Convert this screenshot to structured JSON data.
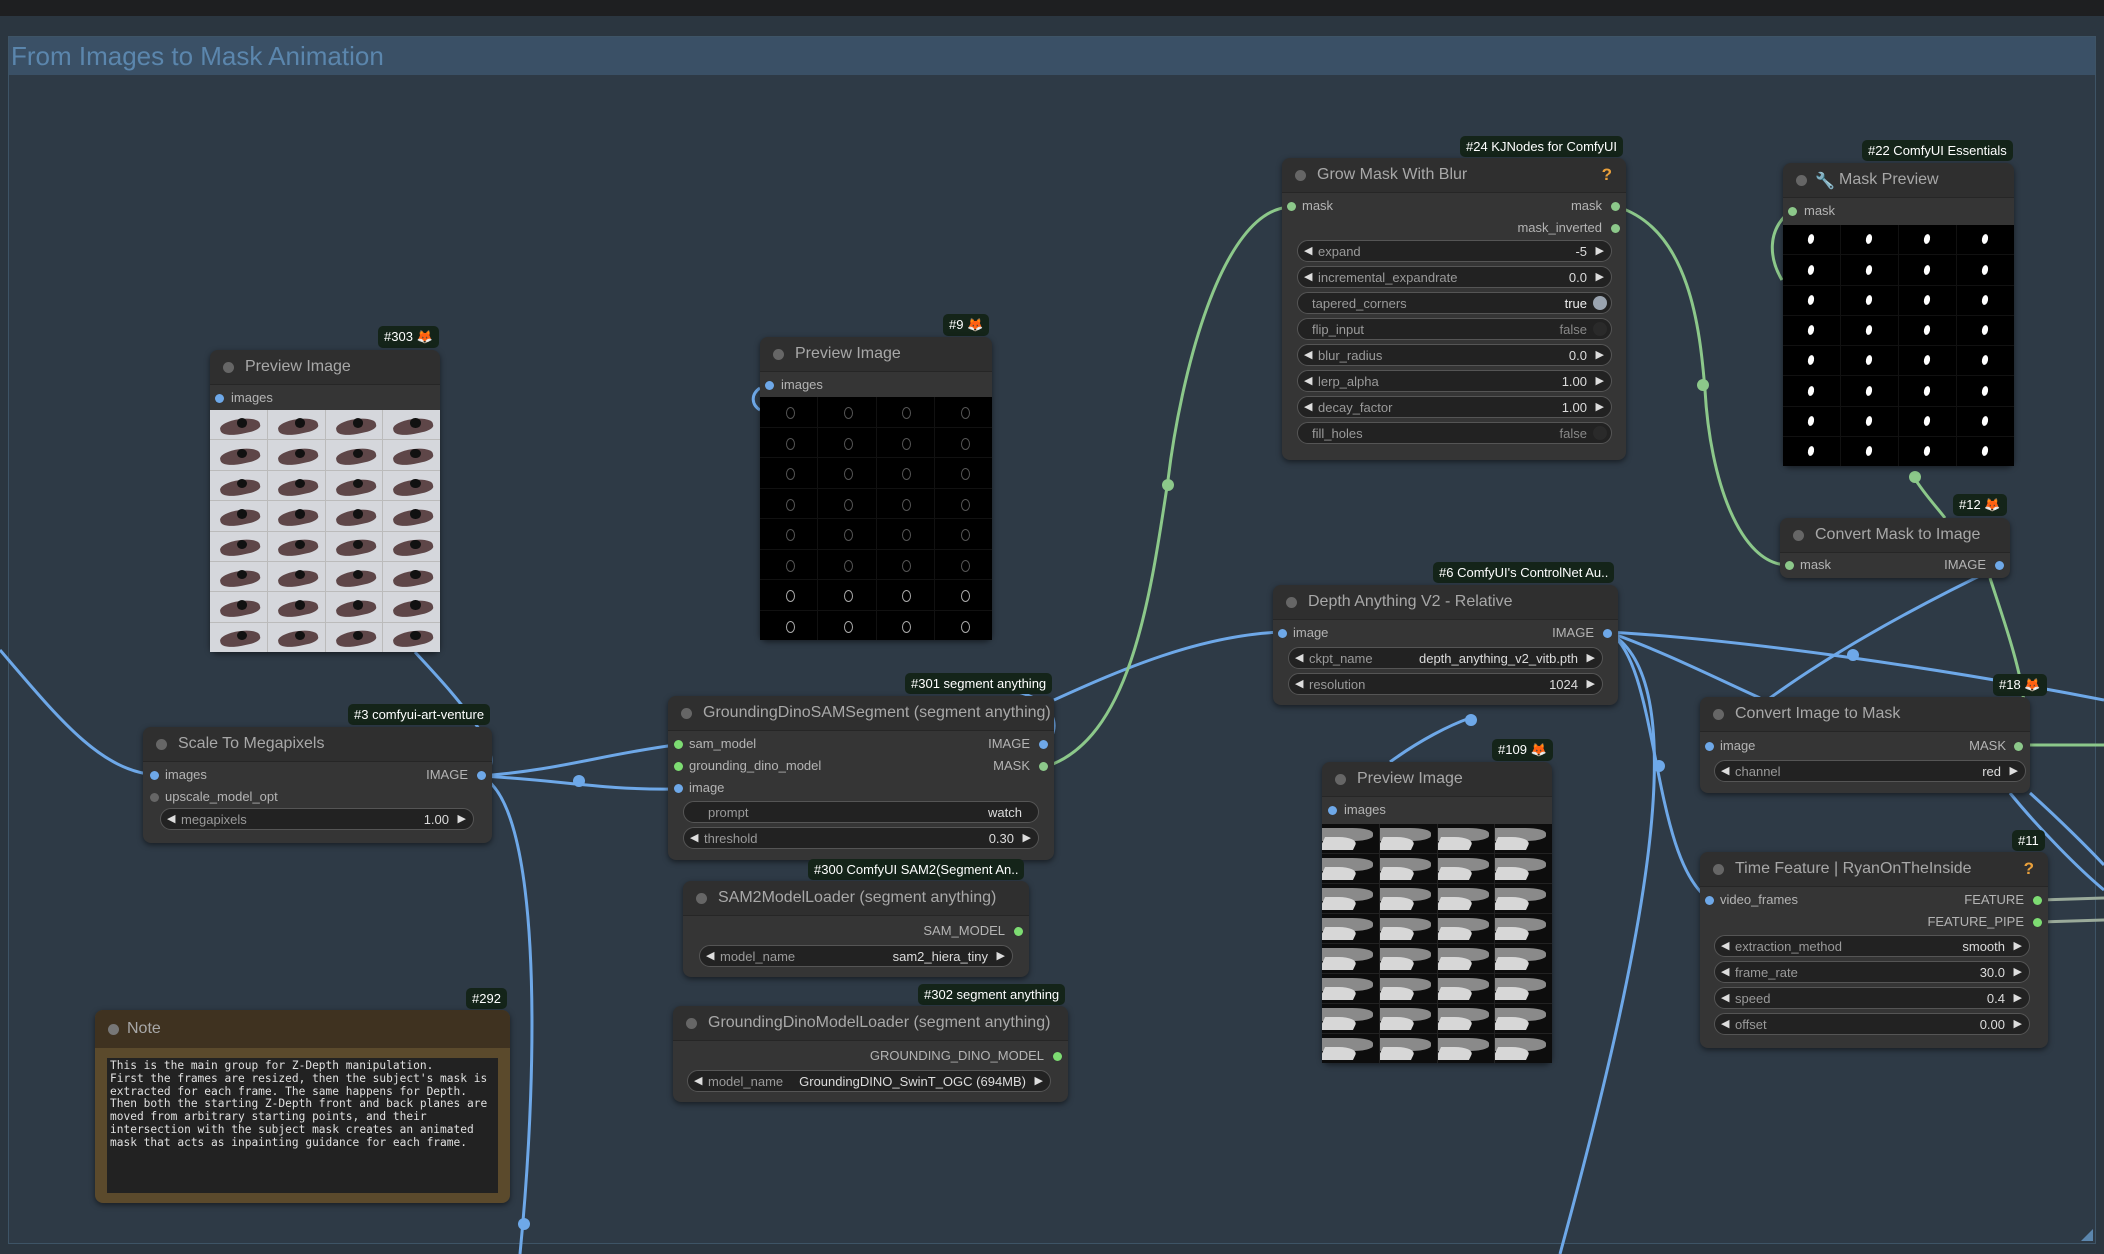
{
  "group": {
    "title": "From Images to Mask Animation"
  },
  "nodes": {
    "n303": {
      "badge": "#303 🦊",
      "title": "Preview Image",
      "inputs": [
        "images"
      ]
    },
    "n9": {
      "badge": "#9 🦊",
      "title": "Preview Image",
      "inputs": [
        "images"
      ]
    },
    "n24": {
      "badge": "#24 KJNodes for ComfyUI",
      "title": "Grow Mask With Blur",
      "help": "?",
      "inputs": [
        "mask"
      ],
      "outputs": [
        "mask",
        "mask_inverted"
      ],
      "widgets": [
        {
          "label": "expand",
          "value": "-5"
        },
        {
          "label": "incremental_expandrate",
          "value": "0.0"
        },
        {
          "label": "tapered_corners",
          "value": "true"
        },
        {
          "label": "flip_input",
          "value": "false"
        },
        {
          "label": "blur_radius",
          "value": "0.0"
        },
        {
          "label": "lerp_alpha",
          "value": "1.00"
        },
        {
          "label": "decay_factor",
          "value": "1.00"
        },
        {
          "label": "fill_holes",
          "value": "false"
        }
      ]
    },
    "n22": {
      "badge": "#22 ComfyUI Essentials",
      "title": "Mask Preview",
      "icon": "🔧",
      "inputs": [
        "mask"
      ]
    },
    "n12": {
      "badge": "#12 🦊",
      "title": "Convert Mask to Image",
      "inputs": [
        "mask"
      ],
      "outputs": [
        "IMAGE"
      ]
    },
    "n6": {
      "badge": "#6 ComfyUI's ControlNet Au..",
      "title": "Depth Anything V2 - Relative",
      "inputs": [
        "image"
      ],
      "outputs": [
        "IMAGE"
      ],
      "widgets": [
        {
          "label": "ckpt_name",
          "value": "depth_anything_v2_vitb.pth"
        },
        {
          "label": "resolution",
          "value": "1024"
        }
      ]
    },
    "n3": {
      "badge": "#3 comfyui-art-venture",
      "title": "Scale To Megapixels",
      "inputs": [
        "images",
        "upscale_model_opt"
      ],
      "outputs": [
        "IMAGE"
      ],
      "widgets": [
        {
          "label": "megapixels",
          "value": "1.00"
        }
      ]
    },
    "n301": {
      "badge": "#301 segment anything",
      "title": "GroundingDinoSAMSegment (segment anything)",
      "inputs": [
        "sam_model",
        "grounding_dino_model",
        "image"
      ],
      "outputs": [
        "IMAGE",
        "MASK"
      ],
      "widgets": [
        {
          "label": "prompt",
          "value": "watch"
        },
        {
          "label": "threshold",
          "value": "0.30"
        }
      ]
    },
    "n300": {
      "badge": "#300 ComfyUI SAM2(Segment An..",
      "title": "SAM2ModelLoader (segment anything)",
      "outputs": [
        "SAM_MODEL"
      ],
      "widgets": [
        {
          "label": "model_name",
          "value": "sam2_hiera_tiny"
        }
      ]
    },
    "n302": {
      "badge": "#302 segment anything",
      "title": "GroundingDinoModelLoader (segment anything)",
      "outputs": [
        "GROUNDING_DINO_MODEL"
      ],
      "widgets": [
        {
          "label": "model_name",
          "value": "GroundingDINO_SwinT_OGC (694MB)"
        }
      ]
    },
    "n109": {
      "badge": "#109 🦊",
      "title": "Preview Image",
      "inputs": [
        "images"
      ]
    },
    "n18": {
      "badge": "#18 🦊",
      "title": "Convert Image to Mask",
      "inputs": [
        "image"
      ],
      "outputs": [
        "MASK"
      ],
      "widgets": [
        {
          "label": "channel",
          "value": "red"
        }
      ]
    },
    "n11": {
      "badge": "#11",
      "title": "Time Feature | RyanOnTheInside",
      "help": "?",
      "inputs": [
        "video_frames"
      ],
      "outputs": [
        "FEATURE",
        "FEATURE_PIPE"
      ],
      "widgets": [
        {
          "label": "extraction_method",
          "value": "smooth"
        },
        {
          "label": "frame_rate",
          "value": "30.0"
        },
        {
          "label": "speed",
          "value": "0.4"
        },
        {
          "label": "offset",
          "value": "0.00"
        }
      ]
    },
    "n292": {
      "badge": "#292",
      "title": "Note",
      "text": "This is the main group for Z-Depth manipulation.\nFirst the frames are resized, then the subject's mask is\nextracted for each frame. The same happens for Depth.\nThen both the starting Z-Depth front and back planes are\nmoved from arbitrary starting points, and their\nintersection with the subject mask creates an animated\nmask that acts as inpainting guidance for each frame."
    }
  },
  "colors": {
    "canvas": "#2b3640",
    "node_body": "#353535",
    "node_header": "#2f2f2f",
    "image_link": "#6ea8e8",
    "mask_link": "#8cc88a",
    "feature_link": "#9aaa9a",
    "help_icon": "#e9a03b",
    "badge_bg": "#142419",
    "group_title": "#5b86ad"
  },
  "preview_grids": {
    "columns": 4,
    "rows": 8
  }
}
